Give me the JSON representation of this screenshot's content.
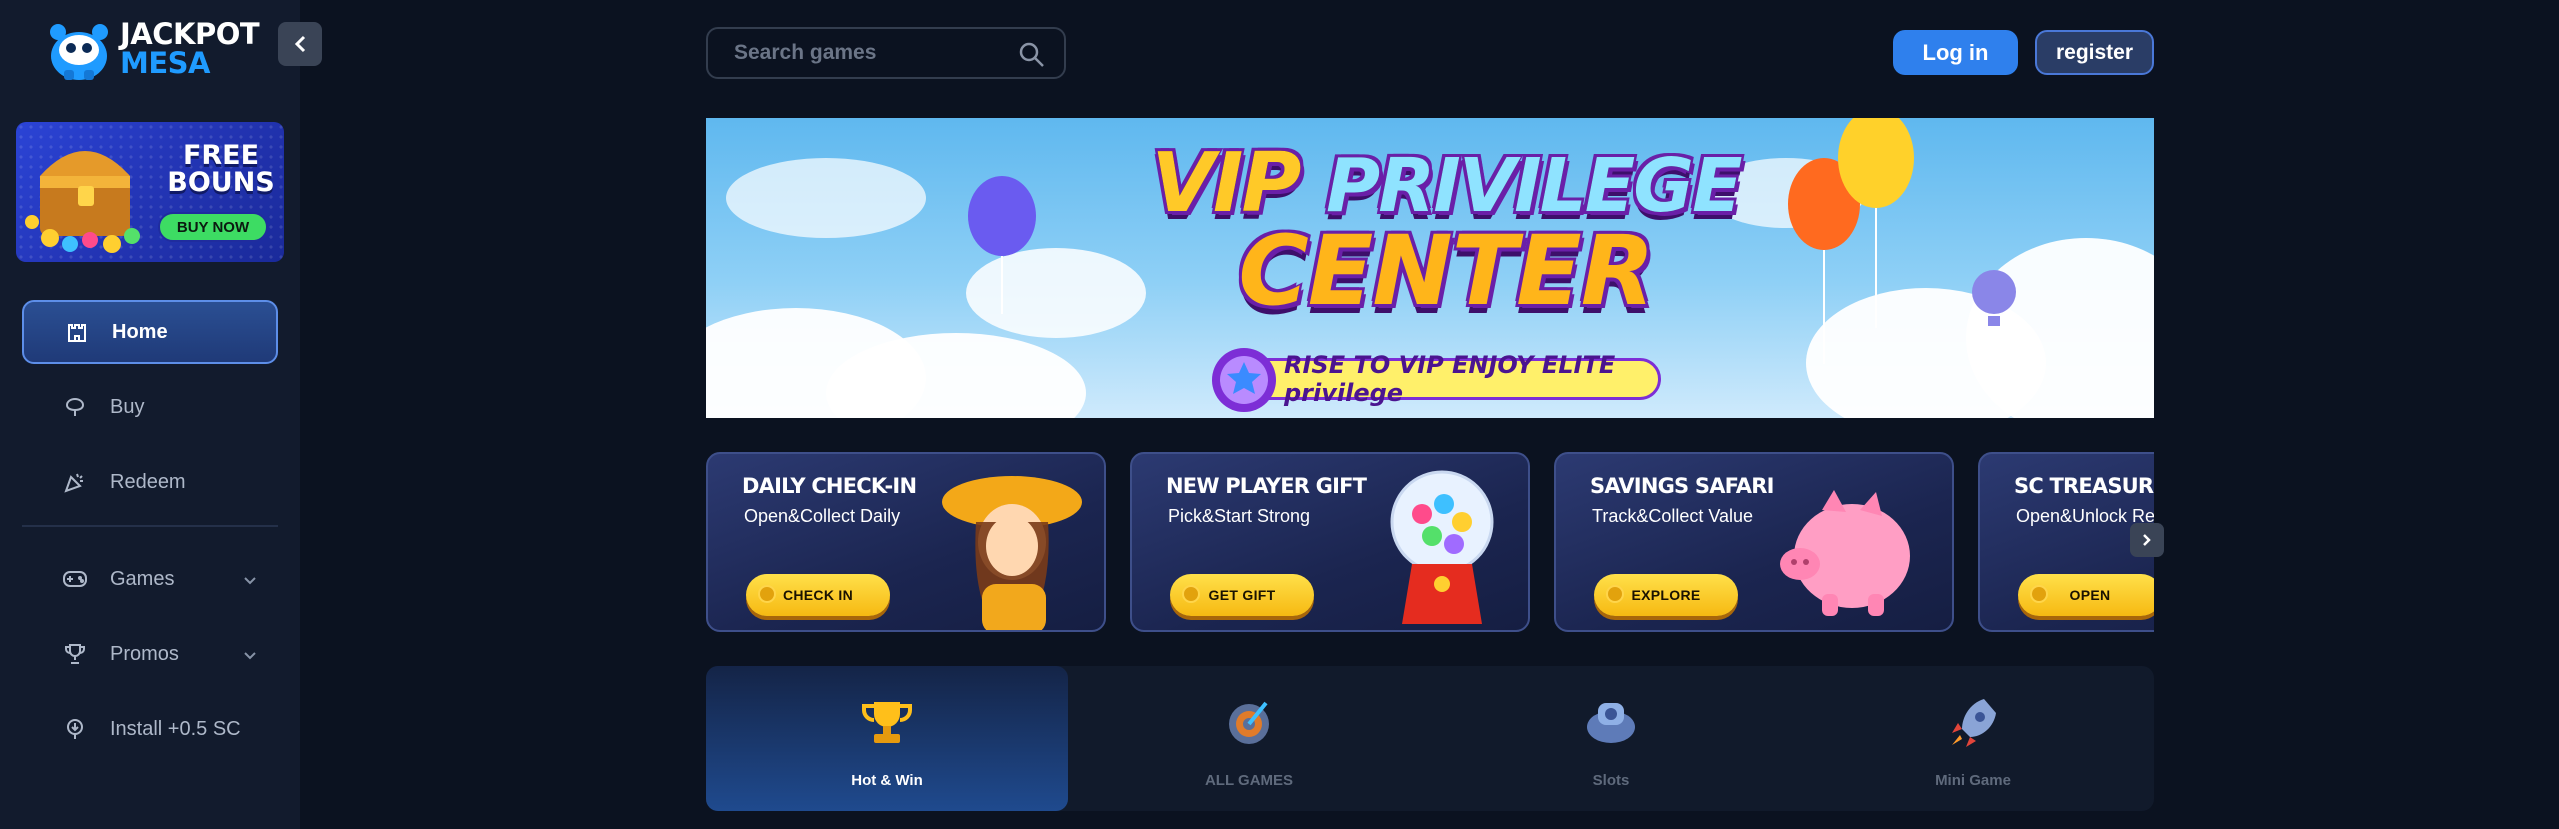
{
  "brand": {
    "name_line1": "JACKPOT",
    "name_line2": "MESA",
    "accent": "#1f9bff"
  },
  "sidebar": {
    "promo": {
      "title": "FREE BOUNS",
      "button": "BUY NOW"
    },
    "items": [
      {
        "label": "Home",
        "icon": "castle-icon",
        "active": true
      },
      {
        "label": "Buy",
        "icon": "shop-icon"
      },
      {
        "label": "Redeem",
        "icon": "party-popper-icon"
      },
      {
        "label": "Games",
        "icon": "gamepad-icon",
        "expandable": true
      },
      {
        "label": "Promos",
        "icon": "trophy-icon",
        "expandable": true
      },
      {
        "label": "Install +0.5 SC",
        "icon": "download-icon"
      }
    ]
  },
  "header": {
    "search_placeholder": "Search games",
    "login": "Log in",
    "register": "register",
    "login_color": "#2f80ed"
  },
  "banner": {
    "title_word1": "VIP",
    "title_word2": "PRIVILEGE",
    "title_line2": "CENTER",
    "subtitle": "RISE TO VIP ENJOY ELITE privilege"
  },
  "cards": [
    {
      "title": "DAILY CHECK-IN",
      "subtitle": "Open&Collect Daily",
      "button": "CHECK IN"
    },
    {
      "title": "NEW PLAYER GIFT",
      "subtitle": "Pick&Start Strong",
      "button": "GET GIFT"
    },
    {
      "title": "SAVINGS SAFARI",
      "subtitle": "Track&Collect Value",
      "button": "EXPLORE"
    },
    {
      "title": "SC TREASURE VAULT",
      "subtitle": "Open&Unlock Rewards",
      "button": "OPEN"
    }
  ],
  "categories": [
    {
      "label": "Hot & Win",
      "icon": "trophy-icon",
      "active": true
    },
    {
      "label": "ALL GAMES",
      "icon": "target-icon"
    },
    {
      "label": "Slots",
      "icon": "slot-machine-icon"
    },
    {
      "label": "Mini Game",
      "icon": "rocket-icon"
    }
  ]
}
